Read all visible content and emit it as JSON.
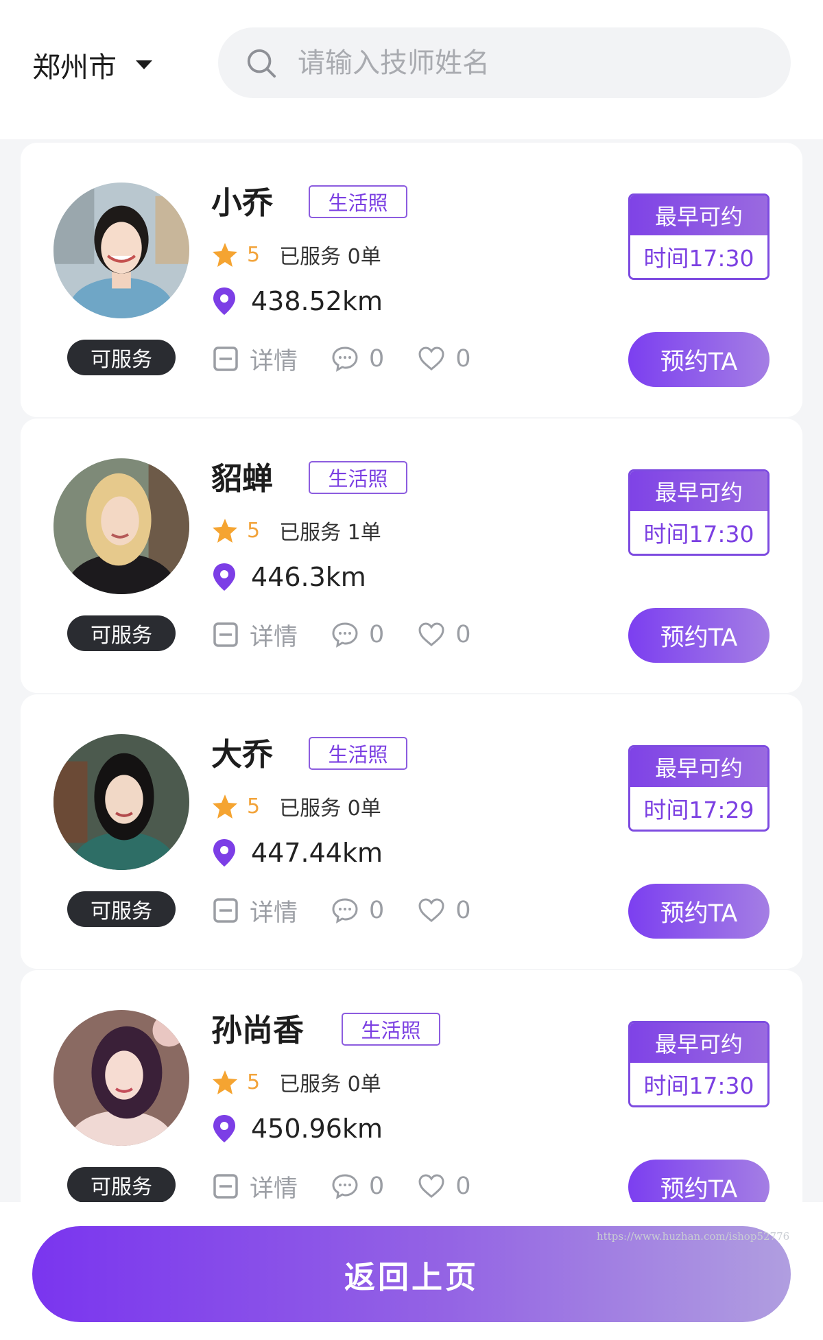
{
  "header": {
    "city": "郑州市",
    "search_placeholder": "请输入技师姓名"
  },
  "accent_color": "#7b3fe2",
  "therapists": [
    {
      "name": "小乔",
      "photo_tag": "生活照",
      "rating": "5",
      "served": "已服务 0单",
      "distance": "438.52km",
      "status": "可服务",
      "detail_label": "详情",
      "comments": "0",
      "likes": "0",
      "earliest_label": "最早可约",
      "earliest_time": "时间17:30",
      "book_label": "预约TA"
    },
    {
      "name": "貂蝉",
      "photo_tag": "生活照",
      "rating": "5",
      "served": "已服务 1单",
      "distance": "446.3km",
      "status": "可服务",
      "detail_label": "详情",
      "comments": "0",
      "likes": "0",
      "earliest_label": "最早可约",
      "earliest_time": "时间17:30",
      "book_label": "预约TA"
    },
    {
      "name": "大乔",
      "photo_tag": "生活照",
      "rating": "5",
      "served": "已服务 0单",
      "distance": "447.44km",
      "status": "可服务",
      "detail_label": "详情",
      "comments": "0",
      "likes": "0",
      "earliest_label": "最早可约",
      "earliest_time": "时间17:29",
      "book_label": "预约TA"
    },
    {
      "name": "孙尚香",
      "photo_tag": "生活照",
      "rating": "5",
      "served": "已服务 0单",
      "distance": "450.96km",
      "status": "可服务",
      "detail_label": "详情",
      "comments": "0",
      "likes": "0",
      "earliest_label": "最早可约",
      "earliest_time": "时间17:30",
      "book_label": "预约TA"
    }
  ],
  "footer": {
    "back_label": "返回上页",
    "watermark": "https://www.huzhan.com/ishop52776"
  }
}
